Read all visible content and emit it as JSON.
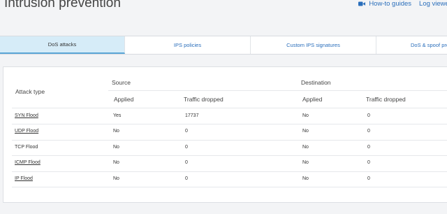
{
  "page": {
    "title": "Intrusion prevention"
  },
  "header": {
    "howto_label": "How-to guides",
    "log_viewer_label": "Log viewer",
    "howto_icon": "video-camera-icon"
  },
  "tabs": [
    {
      "label": "DoS attacks",
      "active": true
    },
    {
      "label": "IPS policies"
    },
    {
      "label": "Custom IPS signatures"
    },
    {
      "label": "DoS & spoof protection"
    }
  ],
  "table": {
    "attack_type_header": "Attack type",
    "source_header": "Source",
    "destination_header": "Destination",
    "applied_header": "Applied",
    "traffic_dropped_header": "Traffic dropped",
    "rows": [
      {
        "attack": "SYN Flood",
        "link": true,
        "src_applied": "Yes",
        "src_dropped": "17737",
        "dst_applied": "No",
        "dst_dropped": "0"
      },
      {
        "attack": "UDP Flood",
        "link": true,
        "src_applied": "No",
        "src_dropped": "0",
        "dst_applied": "No",
        "dst_dropped": "0"
      },
      {
        "attack": "TCP Flood",
        "link": false,
        "src_applied": "No",
        "src_dropped": "0",
        "dst_applied": "No",
        "dst_dropped": "0"
      },
      {
        "attack": "ICMP Flood",
        "link": true,
        "src_applied": "No",
        "src_dropped": "0",
        "dst_applied": "No",
        "dst_dropped": "0"
      },
      {
        "attack": "IP Flood",
        "link": true,
        "src_applied": "No",
        "src_dropped": "0",
        "dst_applied": "No",
        "dst_dropped": "0"
      }
    ]
  },
  "colors": {
    "accent": "#2a6ebb",
    "active_tab": "#d6ecf8"
  }
}
